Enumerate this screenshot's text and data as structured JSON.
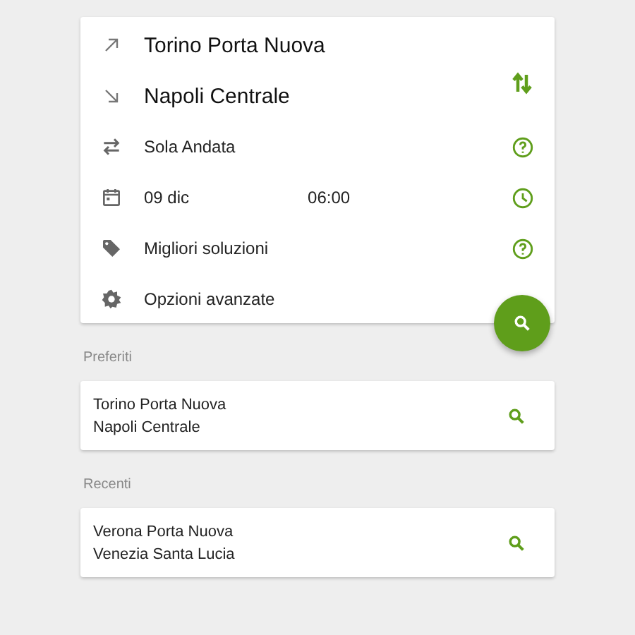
{
  "search_form": {
    "rows": [
      {
        "kind": "departure",
        "label": "Torino Porta Nuova"
      },
      {
        "kind": "arrival",
        "label": "Napoli Centrale"
      },
      {
        "kind": "trip_type",
        "label": "Sola Andata"
      },
      {
        "kind": "date",
        "label": "09 dic",
        "time": "06:00"
      },
      {
        "kind": "fare",
        "label": "Migliori soluzioni"
      },
      {
        "kind": "advanced",
        "label": "Opzioni avanzate"
      }
    ]
  },
  "sections": [
    {
      "title": "Preferiti",
      "items": [
        {
          "from": "Torino Porta Nuova",
          "to": "Napoli Centrale"
        }
      ]
    },
    {
      "title": "Recenti",
      "items": [
        {
          "from": "Verona Porta Nuova",
          "to": "Venezia Santa Lucia"
        }
      ]
    }
  ]
}
